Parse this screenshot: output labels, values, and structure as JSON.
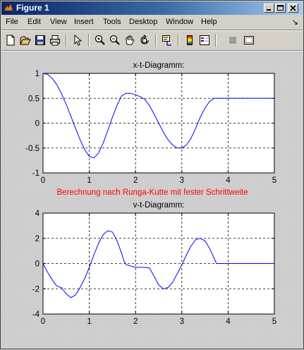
{
  "window": {
    "title": "Figure 1"
  },
  "menu": [
    "File",
    "Edit",
    "View",
    "Insert",
    "Tools",
    "Desktop",
    "Window",
    "Help"
  ],
  "toolbar": [
    "new-figure",
    "open-file",
    "save",
    "print",
    "edit-plot",
    "zoom-in",
    "zoom-out",
    "pan",
    "rotate-3d",
    "data-cursor",
    "colorbar",
    "legend",
    "hide-plot-tools",
    "show-plot-tools"
  ],
  "annotation": {
    "text": "Berechnung nach Runga-Kutte mit fester Schrittweite",
    "color": "#ff0000"
  },
  "chart_data": [
    {
      "type": "line",
      "title": "x-t-Diagramm:",
      "xlim": [
        0,
        5
      ],
      "ylim": [
        -1,
        1
      ],
      "xticks": [
        "0",
        "1",
        "2",
        "3",
        "4",
        "5"
      ],
      "yticks": [
        "1",
        "0.5",
        "0",
        "-0.5",
        "-1"
      ],
      "ytick_values": [
        1,
        0.5,
        0,
        -0.5,
        -1
      ],
      "grid": true,
      "color": "#0000ff",
      "x": [
        0,
        0.1,
        0.2,
        0.3,
        0.4,
        0.5,
        0.6,
        0.7,
        0.8,
        0.9,
        1.0,
        1.1,
        1.2,
        1.3,
        1.4,
        1.5,
        1.6,
        1.7,
        1.8,
        1.9,
        2.0,
        2.1,
        2.2,
        2.3,
        2.4,
        2.5,
        2.6,
        2.7,
        2.8,
        2.9,
        3.0,
        3.1,
        3.2,
        3.3,
        3.4,
        3.5,
        3.6,
        3.7,
        3.8,
        4.0,
        4.5,
        5.0
      ],
      "y": [
        1.0,
        0.98,
        0.9,
        0.77,
        0.59,
        0.38,
        0.14,
        -0.1,
        -0.33,
        -0.53,
        -0.67,
        -0.7,
        -0.6,
        -0.4,
        -0.15,
        0.12,
        0.36,
        0.55,
        0.6,
        0.6,
        0.57,
        0.53,
        0.48,
        0.35,
        0.18,
        0.0,
        -0.18,
        -0.33,
        -0.44,
        -0.5,
        -0.5,
        -0.44,
        -0.3,
        -0.1,
        0.12,
        0.3,
        0.44,
        0.5,
        0.5,
        0.5,
        0.5,
        0.5
      ]
    },
    {
      "type": "line",
      "title": "v-t-Diagramm:",
      "xlim": [
        0,
        5
      ],
      "ylim": [
        -4,
        4
      ],
      "xticks": [
        "0",
        "1",
        "2",
        "3",
        "4",
        "5"
      ],
      "yticks": [
        "4",
        "2",
        "0",
        "-2",
        "-4"
      ],
      "ytick_values": [
        4,
        2,
        0,
        -2,
        -4
      ],
      "grid": true,
      "color": "#0000ff",
      "x": [
        0,
        0.1,
        0.2,
        0.3,
        0.4,
        0.5,
        0.6,
        0.7,
        0.8,
        0.9,
        1.0,
        1.1,
        1.2,
        1.3,
        1.4,
        1.5,
        1.6,
        1.7,
        1.75,
        1.8,
        2.0,
        2.2,
        2.3,
        2.4,
        2.5,
        2.6,
        2.7,
        2.8,
        2.9,
        3.0,
        3.1,
        3.2,
        3.3,
        3.4,
        3.5,
        3.6,
        3.7,
        3.75,
        3.8,
        4.0,
        4.5,
        5.0
      ],
      "y": [
        0.0,
        -0.7,
        -1.3,
        -1.8,
        -1.9,
        -2.4,
        -2.7,
        -2.5,
        -1.9,
        -1.2,
        -0.3,
        0.7,
        1.6,
        2.3,
        2.6,
        2.5,
        1.8,
        0.8,
        0.2,
        -0.1,
        -0.3,
        -0.3,
        -0.35,
        -1.0,
        -1.7,
        -2.0,
        -1.9,
        -1.5,
        -0.8,
        -0.1,
        0.7,
        1.4,
        1.9,
        2.0,
        1.8,
        1.2,
        0.4,
        0.0,
        0.0,
        0.0,
        0.0,
        0.0
      ]
    }
  ]
}
